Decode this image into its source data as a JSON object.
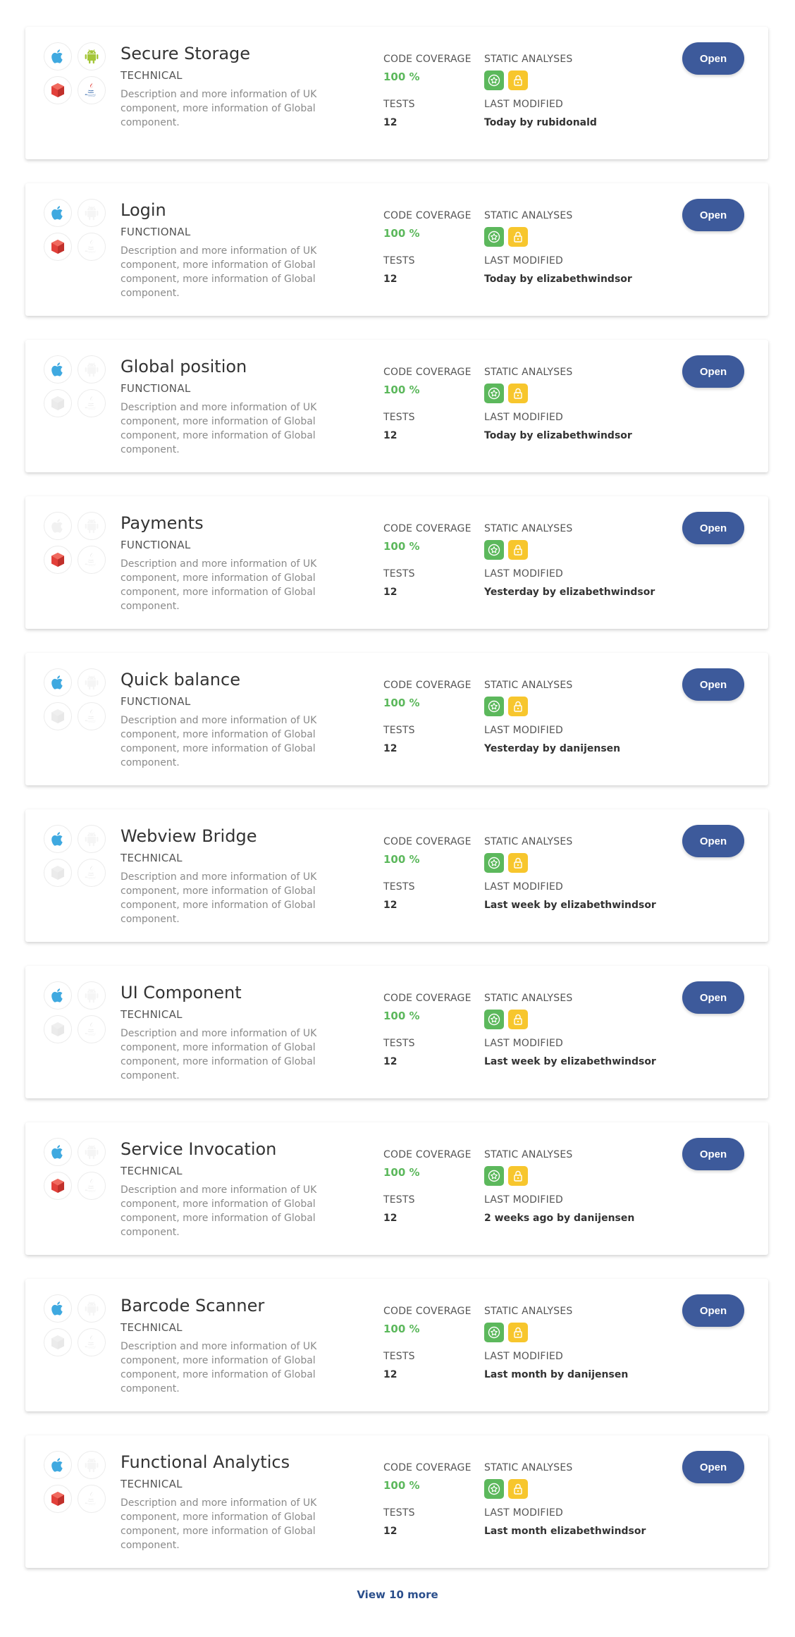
{
  "components": [
    {
      "title": "Secure Storage",
      "type": "TECHNICAL",
      "description": "Description and more information of UK component, more information of Global component.",
      "coverage_label": "CODE COVERAGE",
      "coverage": "100 %",
      "analyses_label": "STATIC ANALYSES",
      "tests_label": "TESTS",
      "tests": "12",
      "modified_label": "LAST MODIFIED",
      "modified": "Today by rubidonald",
      "button": "Open",
      "platforms": {
        "ios": true,
        "android": true,
        "web": true,
        "java": true
      }
    },
    {
      "title": "Login",
      "type": "FUNCTIONAL",
      "description": "Description and more information of UK component, more information of Global component, more information of Global component.",
      "coverage_label": "CODE COVERAGE",
      "coverage": "100 %",
      "analyses_label": "STATIC ANALYSES",
      "tests_label": "TESTS",
      "tests": "12",
      "modified_label": "LAST MODIFIED",
      "modified": "Today by elizabethwindsor",
      "button": "Open",
      "platforms": {
        "ios": true,
        "android": false,
        "web": true,
        "java": false
      }
    },
    {
      "title": "Global position",
      "type": "FUNCTIONAL",
      "description": "Description and more information of UK component, more information of Global component, more information of Global component.",
      "coverage_label": "CODE COVERAGE",
      "coverage": "100 %",
      "analyses_label": "STATIC ANALYSES",
      "tests_label": "TESTS",
      "tests": "12",
      "modified_label": "LAST MODIFIED",
      "modified": "Today by elizabethwindsor",
      "button": "Open",
      "platforms": {
        "ios": true,
        "android": false,
        "web": false,
        "java": false
      }
    },
    {
      "title": "Payments",
      "type": "FUNCTIONAL",
      "description": "Description and more information of UK component, more information of Global component, more information of Global component.",
      "coverage_label": "CODE COVERAGE",
      "coverage": "100 %",
      "analyses_label": "STATIC ANALYSES",
      "tests_label": "TESTS",
      "tests": "12",
      "modified_label": "LAST MODIFIED",
      "modified": "Yesterday by elizabethwindsor",
      "button": "Open",
      "platforms": {
        "ios": false,
        "android": false,
        "web": true,
        "java": false
      }
    },
    {
      "title": "Quick balance",
      "type": "FUNCTIONAL",
      "description": "Description and more information of UK component, more information of Global component, more information of Global component.",
      "coverage_label": "CODE COVERAGE",
      "coverage": "100 %",
      "analyses_label": "STATIC ANALYSES",
      "tests_label": "TESTS",
      "tests": "12",
      "modified_label": "LAST MODIFIED",
      "modified": "Yesterday by danijensen",
      "button": "Open",
      "platforms": {
        "ios": true,
        "android": false,
        "web": false,
        "java": false
      }
    },
    {
      "title": "Webview Bridge",
      "type": "TECHNICAL",
      "description": "Description and more information of UK component, more information of Global component, more information of Global component.",
      "coverage_label": "CODE COVERAGE",
      "coverage": "100 %",
      "analyses_label": "STATIC ANALYSES",
      "tests_label": "TESTS",
      "tests": "12",
      "modified_label": "LAST MODIFIED",
      "modified": "Last week by elizabethwindsor",
      "button": "Open",
      "platforms": {
        "ios": true,
        "android": false,
        "web": false,
        "java": false
      }
    },
    {
      "title": "UI Component",
      "type": "TECHNICAL",
      "description": "Description and more information of UK component, more information of Global component, more information of Global component.",
      "coverage_label": "CODE COVERAGE",
      "coverage": "100 %",
      "analyses_label": "STATIC ANALYSES",
      "tests_label": "TESTS",
      "tests": "12",
      "modified_label": "LAST MODIFIED",
      "modified": "Last week by elizabethwindsor",
      "button": "Open",
      "platforms": {
        "ios": true,
        "android": false,
        "web": false,
        "java": false
      }
    },
    {
      "title": "Service Invocation",
      "type": "TECHNICAL",
      "description": "Description and more information of UK component, more information of Global component, more information of Global component.",
      "coverage_label": "CODE COVERAGE",
      "coverage": "100 %",
      "analyses_label": "STATIC ANALYSES",
      "tests_label": "TESTS",
      "tests": "12",
      "modified_label": "LAST MODIFIED",
      "modified": "2 weeks ago by danijensen",
      "button": "Open",
      "platforms": {
        "ios": true,
        "android": false,
        "web": true,
        "java": false
      }
    },
    {
      "title": "Barcode Scanner",
      "type": "TECHNICAL",
      "description": "Description and more information of UK component, more information of Global component, more information of Global component.",
      "coverage_label": "CODE COVERAGE",
      "coverage": "100 %",
      "analyses_label": "STATIC ANALYSES",
      "tests_label": "TESTS",
      "tests": "12",
      "modified_label": "LAST MODIFIED",
      "modified": "Last month by danijensen",
      "button": "Open",
      "platforms": {
        "ios": true,
        "android": false,
        "web": false,
        "java": false
      }
    },
    {
      "title": "Functional Analytics",
      "type": "TECHNICAL",
      "description": "Description and more information of UK component, more information of Global component, more information of Global component.",
      "coverage_label": "CODE COVERAGE",
      "coverage": "100 %",
      "analyses_label": "STATIC ANALYSES",
      "tests_label": "TESTS",
      "tests": "12",
      "modified_label": "LAST MODIFIED",
      "modified": "Last month elizabethwindsor",
      "button": "Open",
      "platforms": {
        "ios": true,
        "android": false,
        "web": true,
        "java": false
      }
    }
  ],
  "icons": {
    "ios": "apple-icon",
    "android": "android-icon",
    "web": "cube-icon",
    "java": "java-icon",
    "analysis_pass": "star-badge-icon",
    "analysis_security": "lock-badge-icon"
  },
  "colors": {
    "primary_button": "#3d5a9b",
    "coverage_green": "#5cb85c",
    "badge_green": "#5cb85c",
    "badge_yellow": "#f7c62d",
    "ios_blue": "#3fa9e0",
    "android_green": "#a4c639",
    "web_red": "#e2403a"
  },
  "footer": {
    "view_more": "View 10 more"
  }
}
